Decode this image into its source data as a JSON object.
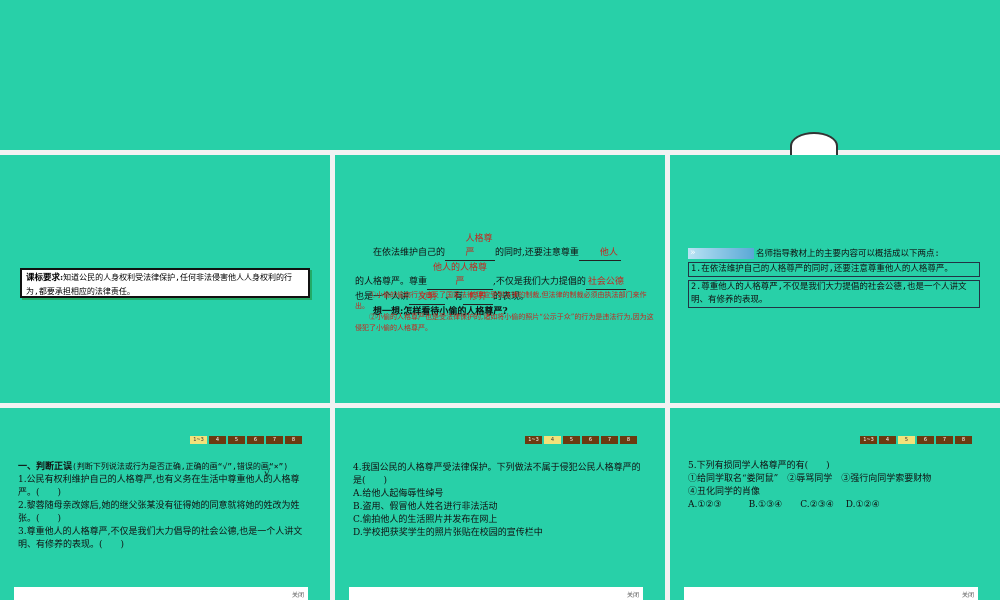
{
  "slide2": {
    "label": "课标要求:",
    "text": "知道公民的人身权利受法律保护,任何非法侵害他人人身权利的行为,都要承担相应的法律责任。"
  },
  "slide3": {
    "p1a": "在依法维护自己的",
    "b1": "人格尊严",
    "p1b": "的同时,还要注意尊重",
    "b2": "他人",
    "p2a": "的人格尊严。尊重",
    "b3": "他人的人格尊严",
    "p2b": ",不仅是我们大力提倡的",
    "b4": "社会公德",
    "p3a": "也是一个人讲",
    "b5": "文明",
    "p3b": "、有",
    "b6": "修养",
    "p3c": "的表现。",
    "think": "想一想:怎样看待小偷的人格尊严?",
    "a1": "①小偷的偷窃行为违反了国家法律,理应受到法律的制裁,但法律的制裁必须由执法部门来作出。",
    "a2": "②小偷的人格尊严也是受法律保护的,诸如将小偷的照片“公示于众”的行为是违法行为,因为这侵犯了小偷的人格尊严。"
  },
  "slide4": {
    "header": "名师指导教材上的主要内容可以概括成以下两点:",
    "items": [
      "1.在依法维护自己的人格尊严的同时,还要注意尊重他人的人格尊严。",
      "2.尊重他人的人格尊严,不仅是我们大力提倡的社会公德,也是一个人讲文明、有修养的表现。"
    ]
  },
  "pager": [
    "1~3",
    "4",
    "5",
    "6",
    "7",
    "8"
  ],
  "close_label": "关闭",
  "slide5": {
    "heading": "一、判断正误",
    "hint": "(判断下列说法或行为是否正确,正确的画“√”,错误的画“×”)",
    "check": "√",
    "q1": "1.公民有权利维护自己的人格尊严,也有义务在生活中尊重他人的人格尊严。(　　)",
    "q2": "2.黎蓉随母亲改嫁后,她的继父张某没有征得她的同意就将她的姓改为姓张。(　　)",
    "q3": "3.尊重他人的人格尊严,不仅是我们大力倡导的社会公德,也是一个人讲文明、有修养的表现。(　　)"
  },
  "slide6": {
    "q": "4.我国公民的人格尊严受法律保护。下列做法不属于侵犯公民人格尊严的是(　　)",
    "opts": [
      "A.给他人起侮辱性绰号",
      "B.盗用、假冒他人姓名进行非法活动",
      "C.偷拍他人的生活照片并发布在网上",
      "D.学校把获奖学生的照片张贴在校园的宣传栏中"
    ]
  },
  "slide7": {
    "q": "5.下列有损同学人格尊严的有(　　)",
    "l1": "①给同学取名“娄阿鼠”　②辱骂同学　③强行向同学索要财物",
    "l2": "④丑化同学的肖像",
    "opts": "A.①②③　　　B.①③④　　C.②③④　 D.①②④"
  }
}
